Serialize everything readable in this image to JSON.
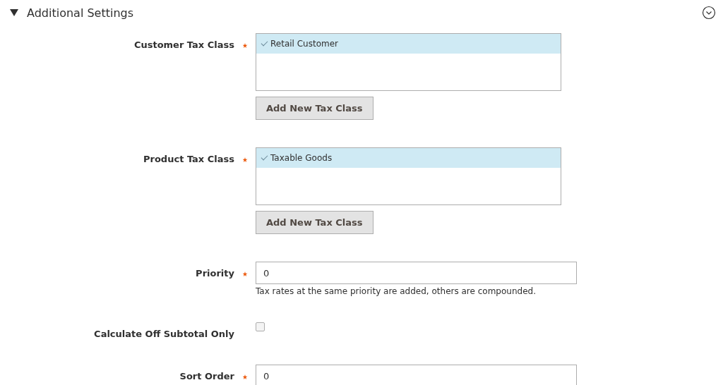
{
  "section": {
    "title": "Additional Settings",
    "expanded": true
  },
  "fields": [
    {
      "kind": "multiselect",
      "label": "Customer Tax Class",
      "required": true,
      "options": [
        {
          "label": "Retail Customer",
          "selected": true
        }
      ],
      "button": "Add New Tax Class"
    },
    {
      "kind": "multiselect",
      "label": "Product Tax Class",
      "required": true,
      "options": [
        {
          "label": "Taxable Goods",
          "selected": true
        }
      ],
      "button": "Add New Tax Class"
    },
    {
      "kind": "text",
      "label": "Priority",
      "required": true,
      "value": "0",
      "note": "Tax rates at the same priority are added, others are compounded."
    },
    {
      "kind": "checkbox",
      "label": "Calculate Off Subtotal Only",
      "required": false,
      "checked": false
    },
    {
      "kind": "text",
      "label": "Sort Order",
      "required": true,
      "value": "0"
    }
  ]
}
